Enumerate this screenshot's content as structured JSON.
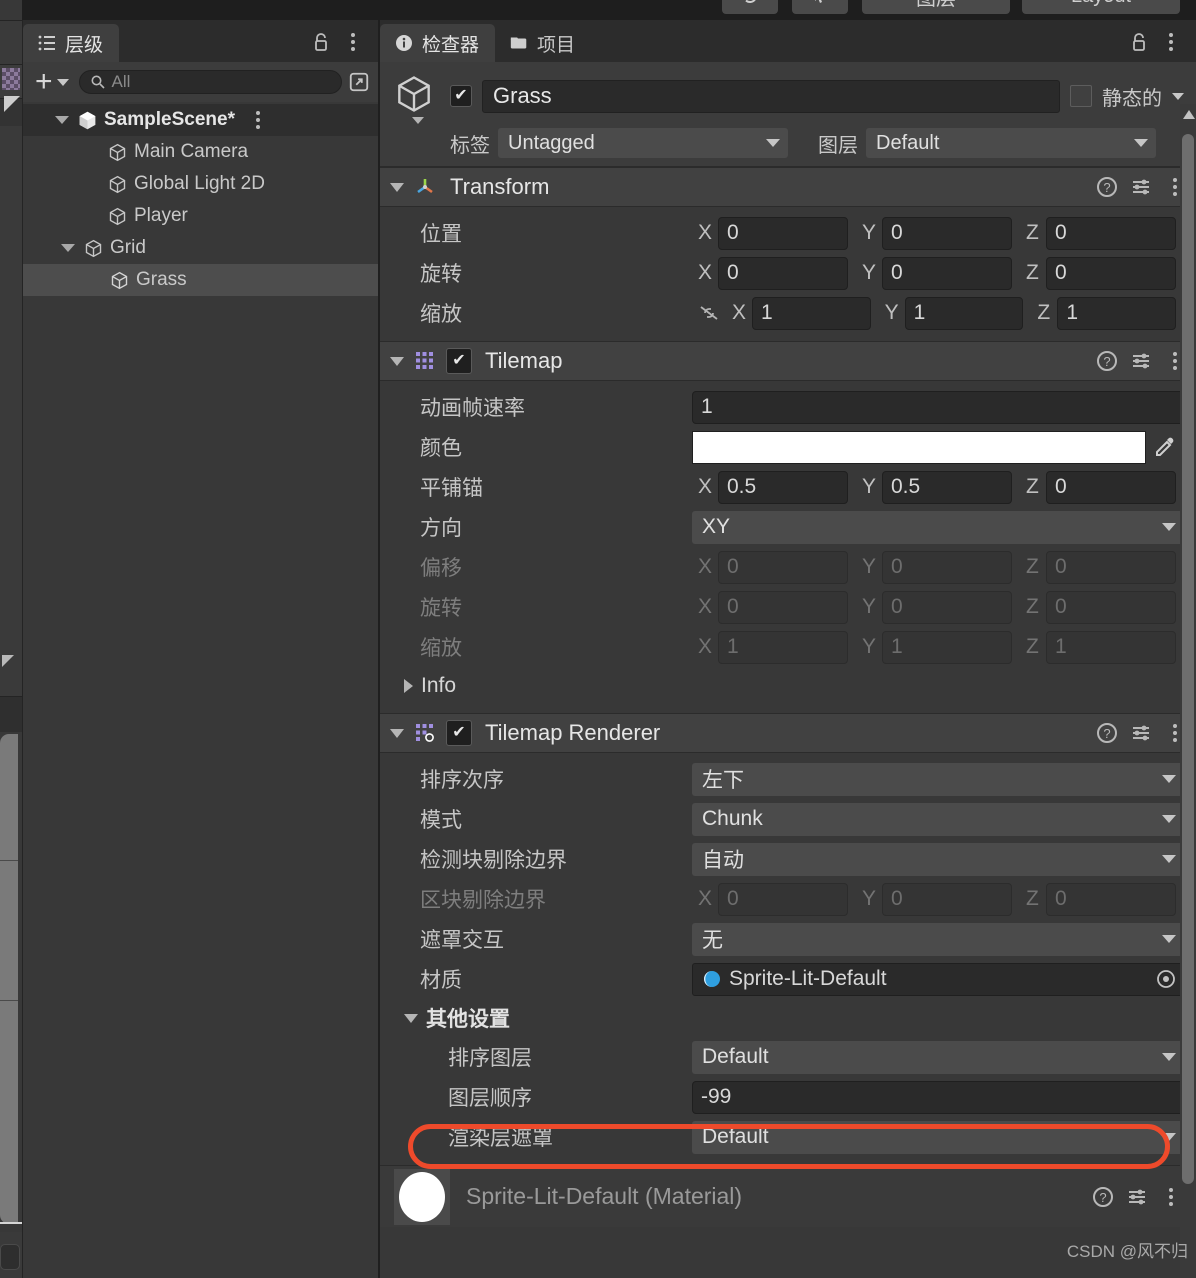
{
  "toolbar": {
    "chips": [
      {
        "label": "",
        "icon": "undo-icon"
      },
      {
        "label": "",
        "icon": "cursor-icon"
      },
      {
        "label": "图层",
        "icon": "layers-dropdown"
      },
      {
        "label": "Layout",
        "icon": "layout-dropdown"
      }
    ]
  },
  "hierarchy": {
    "tab_label": "层级",
    "search_placeholder": "All",
    "search_value": "",
    "tree": [
      {
        "label": "SampleScene*",
        "depth": 0,
        "expanded": true,
        "selected": false,
        "scene": true
      },
      {
        "label": "Main Camera",
        "depth": 1,
        "expanded": null,
        "selected": false,
        "scene": false
      },
      {
        "label": "Global Light 2D",
        "depth": 1,
        "expanded": null,
        "selected": false,
        "scene": false
      },
      {
        "label": "Player",
        "depth": 1,
        "expanded": null,
        "selected": false,
        "scene": false
      },
      {
        "label": "Grid",
        "depth": 1,
        "expanded": true,
        "selected": false,
        "scene": false
      },
      {
        "label": "Grass",
        "depth": 2,
        "expanded": null,
        "selected": true,
        "scene": false
      }
    ]
  },
  "inspector": {
    "tabs": [
      {
        "label": "检查器",
        "icon": "info-icon",
        "active": true
      },
      {
        "label": "项目",
        "icon": "folder-icon",
        "active": false
      }
    ],
    "object": {
      "enabled": true,
      "name": "Grass",
      "static_label": "静态的",
      "static_checked": false,
      "tag_label": "标签",
      "tag_value": "Untagged",
      "layer_label": "图层",
      "layer_value": "Default"
    },
    "transform": {
      "title": "Transform",
      "expanded": true,
      "rows": [
        {
          "label": "位置",
          "x": "0",
          "y": "0",
          "z": "0",
          "dim": false,
          "link": false
        },
        {
          "label": "旋转",
          "x": "0",
          "y": "0",
          "z": "0",
          "dim": false,
          "link": false
        },
        {
          "label": "缩放",
          "x": "1",
          "y": "1",
          "z": "1",
          "dim": false,
          "link": true
        }
      ]
    },
    "tilemap": {
      "title": "Tilemap",
      "expanded": true,
      "enabled": true,
      "anim_frame_rate_label": "动画帧速率",
      "anim_frame_rate_value": "1",
      "color_label": "颜色",
      "color_value": "#FFFFFF",
      "tile_anchor_label": "平铺锚",
      "tile_anchor": {
        "x": "0.5",
        "y": "0.5",
        "z": "0"
      },
      "orientation_label": "方向",
      "orientation_value": "XY",
      "offset_label": "偏移",
      "offset": {
        "x": "0",
        "y": "0",
        "z": "0"
      },
      "rotation_label": "旋转",
      "rotation": {
        "x": "0",
        "y": "0",
        "z": "0"
      },
      "scale_label": "缩放",
      "scale": {
        "x": "1",
        "y": "1",
        "z": "1"
      },
      "info_label": "Info"
    },
    "tilemap_renderer": {
      "title": "Tilemap Renderer",
      "expanded": true,
      "enabled": true,
      "sort_order_label": "排序次序",
      "sort_order_value": "左下",
      "mode_label": "模式",
      "mode_value": "Chunk",
      "detect_chunk_culling_label": "检测块剔除边界",
      "detect_chunk_culling_value": "自动",
      "chunk_culling_bounds_label": "区块剔除边界",
      "chunk_culling_bounds": {
        "x": "0",
        "y": "0",
        "z": "0"
      },
      "mask_interaction_label": "遮罩交互",
      "mask_interaction_value": "无",
      "material_label": "材质",
      "material_value": "Sprite-Lit-Default",
      "additional_settings_label": "其他设置",
      "sorting_layer_label": "排序图层",
      "sorting_layer_value": "Default",
      "order_in_layer_label": "图层顺序",
      "order_in_layer_value": "-99",
      "rendering_layer_mask_label": "渲染层遮罩",
      "rendering_layer_mask_value": "Default"
    },
    "material_preview": {
      "title": "Sprite-Lit-Default (Material)"
    }
  },
  "annotation": {
    "highlight_color": "#ee4a2b",
    "highlighted_field": "图层顺序"
  },
  "watermark": "CSDN @风不归"
}
